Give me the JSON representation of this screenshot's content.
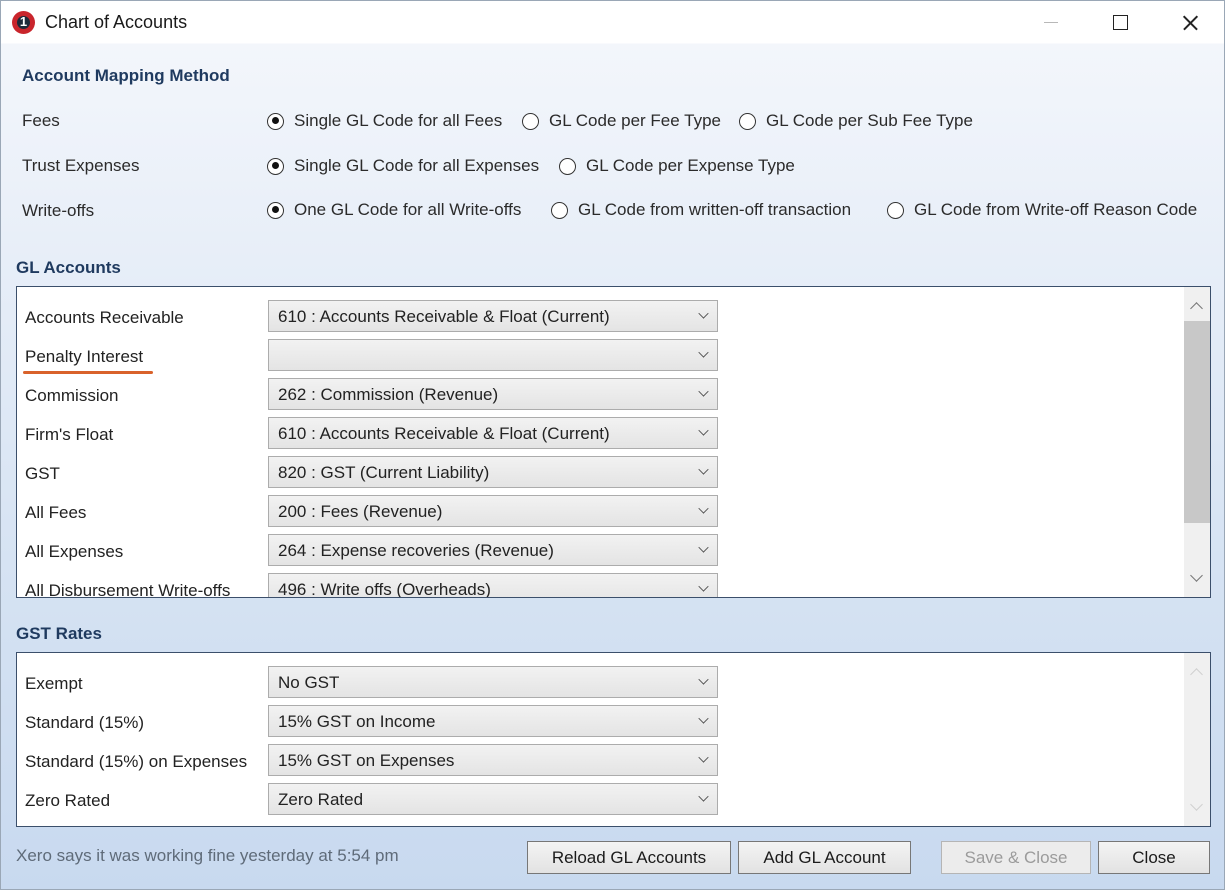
{
  "window": {
    "title": "Chart of Accounts",
    "app_icon_text": "1"
  },
  "mapping": {
    "title": "Account Mapping Method",
    "rows": [
      {
        "label": "Fees",
        "options": [
          "Single GL Code for all Fees",
          "GL Code per Fee Type",
          "GL Code per Sub Fee Type"
        ],
        "selected": 0
      },
      {
        "label": "Trust Expenses",
        "options": [
          "Single GL Code for all Expenses",
          "GL Code per Expense Type"
        ],
        "selected": 0
      },
      {
        "label": "Write-offs",
        "options": [
          "One GL Code for all Write-offs",
          "GL Code from written-off transaction",
          "GL Code from Write-off Reason Code"
        ],
        "selected": 0
      }
    ]
  },
  "gl_accounts": {
    "title": "GL Accounts",
    "rows": [
      {
        "label": "Accounts Receivable",
        "value": "610 : Accounts Receivable & Float (Current)"
      },
      {
        "label": "Penalty Interest",
        "value": ""
      },
      {
        "label": "Commission",
        "value": "262 : Commission (Revenue)"
      },
      {
        "label": "Firm's Float",
        "value": "610 : Accounts Receivable & Float (Current)"
      },
      {
        "label": "GST",
        "value": "820 : GST (Current Liability)"
      },
      {
        "label": "All Fees",
        "value": "200 : Fees (Revenue)"
      },
      {
        "label": "All Expenses",
        "value": "264 : Expense recoveries (Revenue)"
      },
      {
        "label": "All Disbursement Write-offs",
        "value": "496 : Write offs (Overheads)"
      }
    ]
  },
  "gst_rates": {
    "title": "GST Rates",
    "rows": [
      {
        "label": "Exempt",
        "value": "No GST"
      },
      {
        "label": "Standard (15%)",
        "value": "15% GST on Income"
      },
      {
        "label": "Standard (15%) on Expenses",
        "value": "15% GST on Expenses"
      },
      {
        "label": "Zero Rated",
        "value": "Zero Rated"
      }
    ]
  },
  "footer": {
    "status": "Xero says it was working fine yesterday at 5:54 pm",
    "reload_label": "Reload GL Accounts",
    "add_label": "Add GL Account",
    "save_close_label": "Save & Close",
    "close_label": "Close"
  },
  "colors": {
    "accent_underline": "#d9622b",
    "section_title": "#1f3a5f",
    "app_icon": "#c9252c"
  }
}
